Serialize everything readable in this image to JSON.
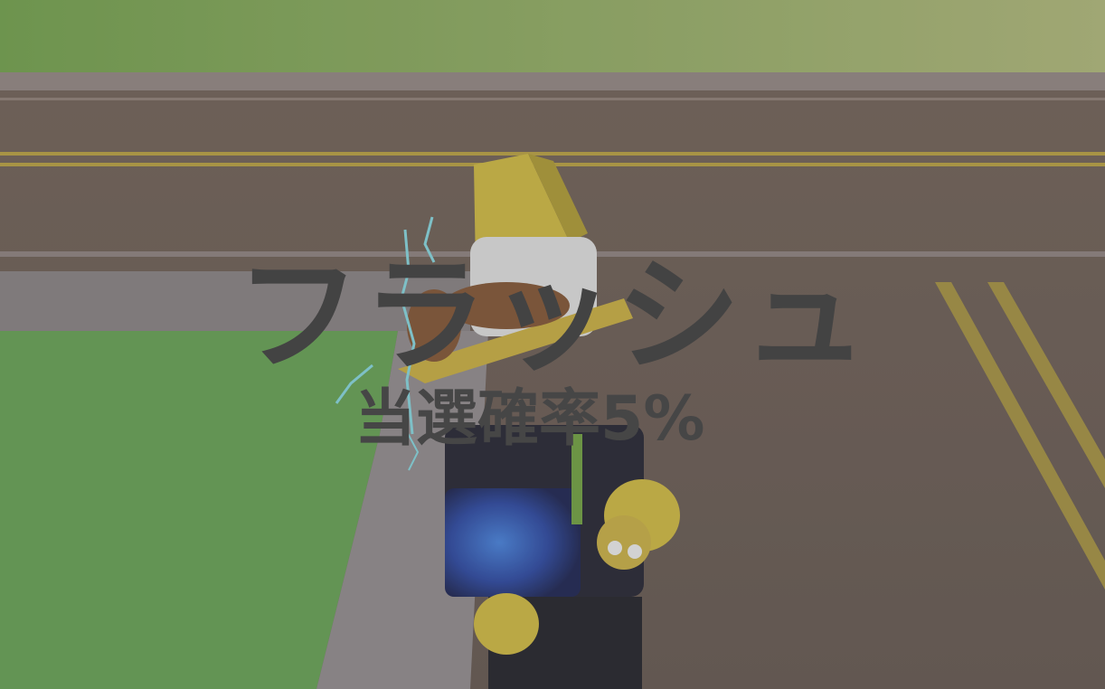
{
  "result": {
    "item_name": "フラッシュ",
    "chance_text": "当選確率5%"
  },
  "colors": {
    "text": "#434343",
    "grass": "#5e9a4c",
    "road": "#5f5148",
    "lane_line": "#b39a3a"
  },
  "scene": {
    "avatar": "roblox-avatar-yellow-cone-hat",
    "held_item": "lightning-staff-icon"
  }
}
